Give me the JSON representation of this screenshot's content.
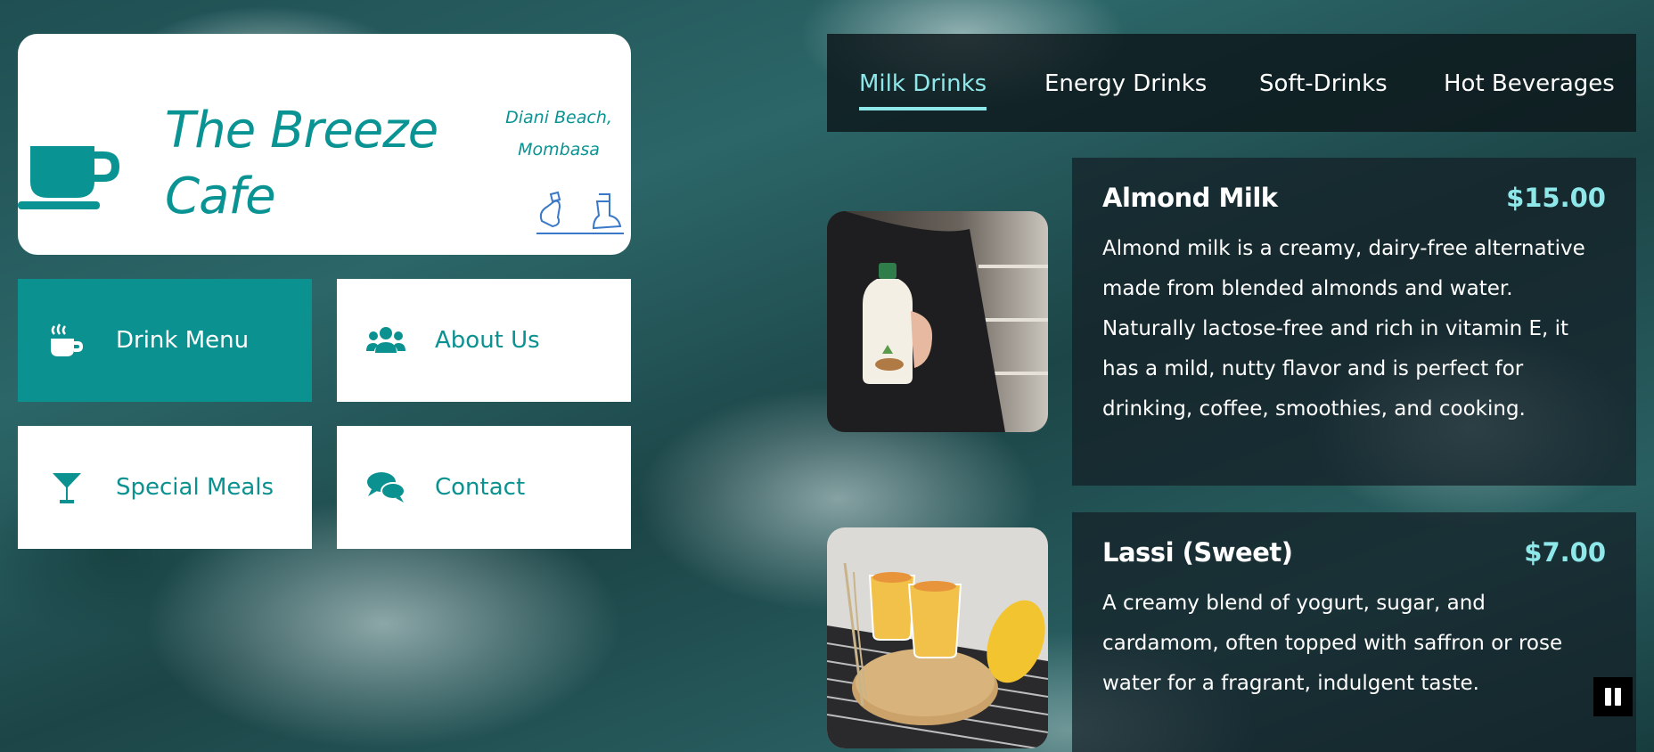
{
  "brand": {
    "title": "The Breeze Cafe",
    "location_line1": "Diani Beach,",
    "location_line2": "Mombasa",
    "accent_color": "#0c9191"
  },
  "nav": [
    {
      "label": "Drink Menu",
      "icon": "coffee-cup-icon",
      "active": true
    },
    {
      "label": "About Us",
      "icon": "users-icon",
      "active": false
    },
    {
      "label": "Special Meals",
      "icon": "cocktail-glass-icon",
      "active": false
    },
    {
      "label": "Contact",
      "icon": "chat-bubbles-icon",
      "active": false
    }
  ],
  "tabs": [
    {
      "label": "Milk Drinks",
      "active": true
    },
    {
      "label": "Energy Drinks",
      "active": false
    },
    {
      "label": "Soft-Drinks",
      "active": false
    },
    {
      "label": "Hot Beverages",
      "active": false
    }
  ],
  "menu_items": [
    {
      "name": "Almond Milk",
      "price": "$15.00",
      "description": "Almond milk is a creamy, dairy-free alternative made from blended almonds and water. Naturally lactose-free and rich in vitamin E, it has a mild, nutty flavor and is perfect for drinking, coffee, smoothies, and cooking.",
      "photo": "almond-milk-bottle-photo"
    },
    {
      "name": "Lassi (Sweet)",
      "price": "$7.00",
      "description": "A creamy blend of yogurt, sugar, and cardamom, often topped with saffron or rose water for a fragrant, indulgent taste.",
      "photo": "mango-lassi-glasses-photo"
    }
  ],
  "controls": {
    "pause_icon": "pause-icon"
  }
}
